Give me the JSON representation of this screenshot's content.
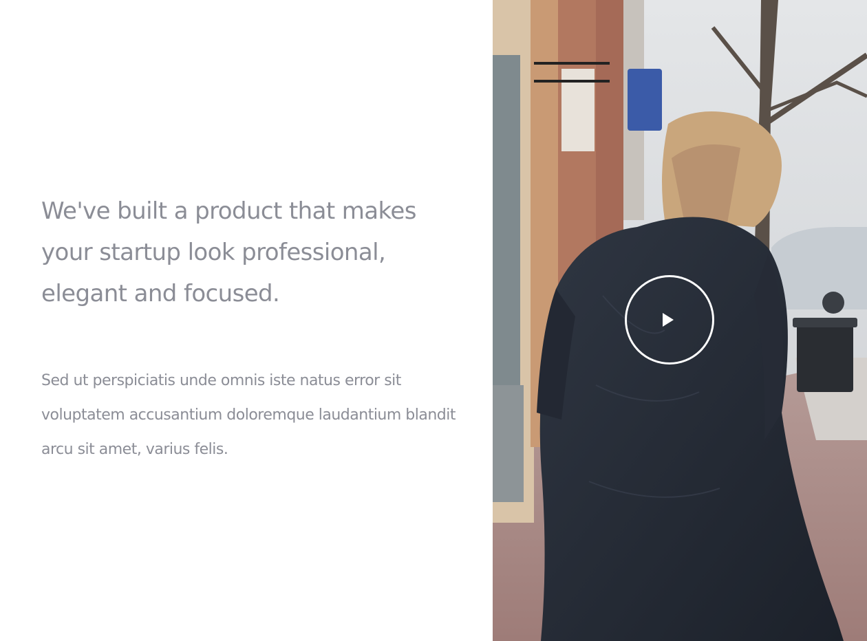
{
  "hero": {
    "headline": "We've built a product that makes your startup look professional, elegant and focused.",
    "body": "Sed ut perspiciatis unde omnis iste natus error sit voluptatem accusantium doloremque laudantium blandit arcu sit amet, varius felis."
  },
  "media": {
    "image_subject": "man walking on sidewalk",
    "play_icon": "play-icon"
  },
  "colors": {
    "text": "#8b8d96",
    "background": "#ffffff",
    "play_control": "#ffffff"
  }
}
